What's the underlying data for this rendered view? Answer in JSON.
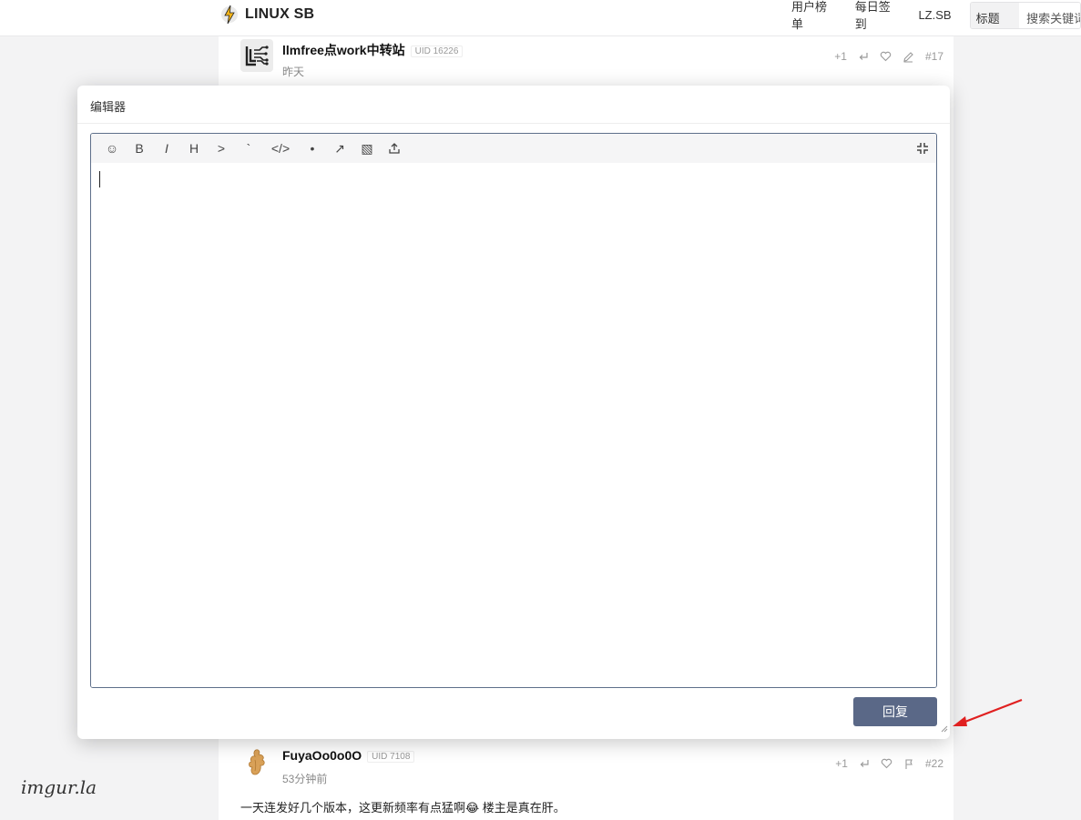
{
  "header": {
    "brand": "LINUX SB",
    "nav": [
      "用户榜单",
      "每日签到",
      "LZ.SB"
    ],
    "search_select": "标题",
    "search_placeholder": "搜索关键词"
  },
  "posts": [
    {
      "username": "llmfree点work中转站",
      "uid": "UID 16226",
      "time": "昨天",
      "plus": "+1",
      "floor": "#17",
      "avatar_icon": "circuit-logo-icon"
    },
    {
      "username": "FuyaOo0o0O",
      "uid": "UID 7108",
      "time": "53分钟前",
      "plus": "+1",
      "floor": "#22",
      "avatar_icon": "ginger-avatar-icon",
      "content": "一天连发好几个版本，这更新频率有点猛啊😂 楼主是真在肝。"
    }
  ],
  "editor": {
    "title": "编辑器",
    "toolbar": {
      "emoji": "☺",
      "bold": "B",
      "italic": "I",
      "heading": "H",
      "quote": ">",
      "inline_code": "`",
      "code_block": "</>",
      "list": "•",
      "link": "↗",
      "image": "▧",
      "upload": "upload-icon",
      "fullscreen": "fullscreen-exit-icon"
    },
    "text": "",
    "reply_button": "回复"
  },
  "watermark": "imgur.la",
  "colors": {
    "accent": "#5a6887",
    "editor_border": "#5e6f8a",
    "annotation_arrow": "#e02020"
  }
}
